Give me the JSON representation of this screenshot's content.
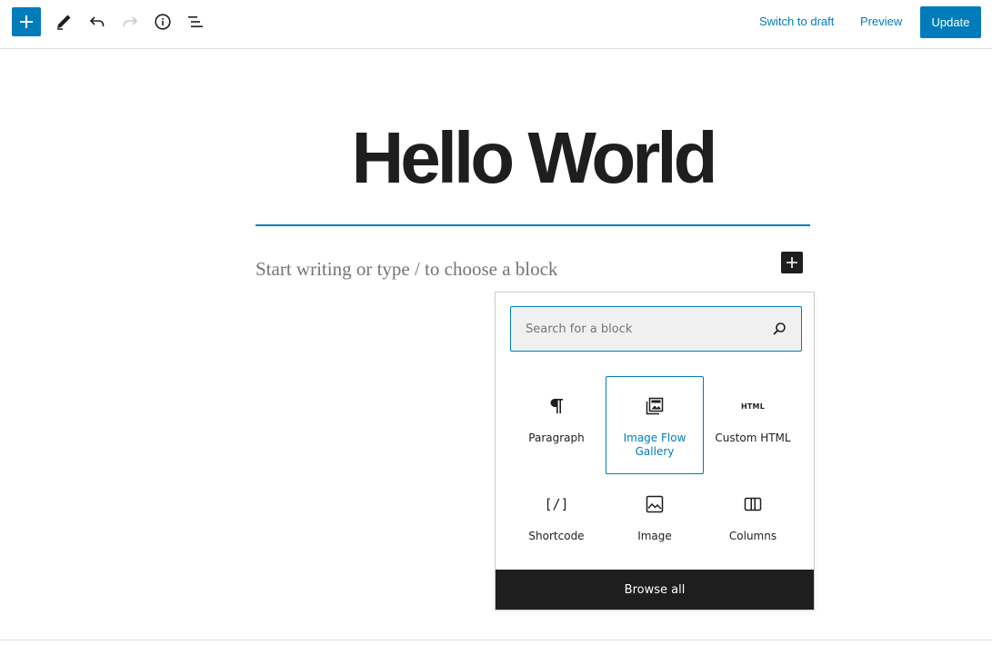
{
  "toolbar": {
    "icons": [
      "plus-icon",
      "pencil-icon",
      "undo-icon",
      "redo-icon",
      "info-icon",
      "list-view-icon"
    ],
    "switch_to_draft": "Switch to draft",
    "preview": "Preview",
    "update": "Update",
    "accent_color": "#007cba"
  },
  "editor": {
    "title": "Hello World",
    "placeholder": "Start writing or type / to choose a block"
  },
  "inserter": {
    "search_placeholder": "Search for a block",
    "blocks": [
      {
        "label": "Paragraph",
        "icon": "paragraph-icon",
        "selected": false
      },
      {
        "label": "Image Flow Gallery",
        "icon": "gallery-icon",
        "selected": true
      },
      {
        "label": "Custom HTML",
        "icon": "html-icon",
        "icon_text": "HTML",
        "selected": false
      },
      {
        "label": "Shortcode",
        "icon": "shortcode-icon",
        "icon_text": "[/]",
        "selected": false
      },
      {
        "label": "Image",
        "icon": "image-icon",
        "selected": false
      },
      {
        "label": "Columns",
        "icon": "columns-icon",
        "selected": false
      }
    ],
    "browse_all": "Browse all"
  }
}
